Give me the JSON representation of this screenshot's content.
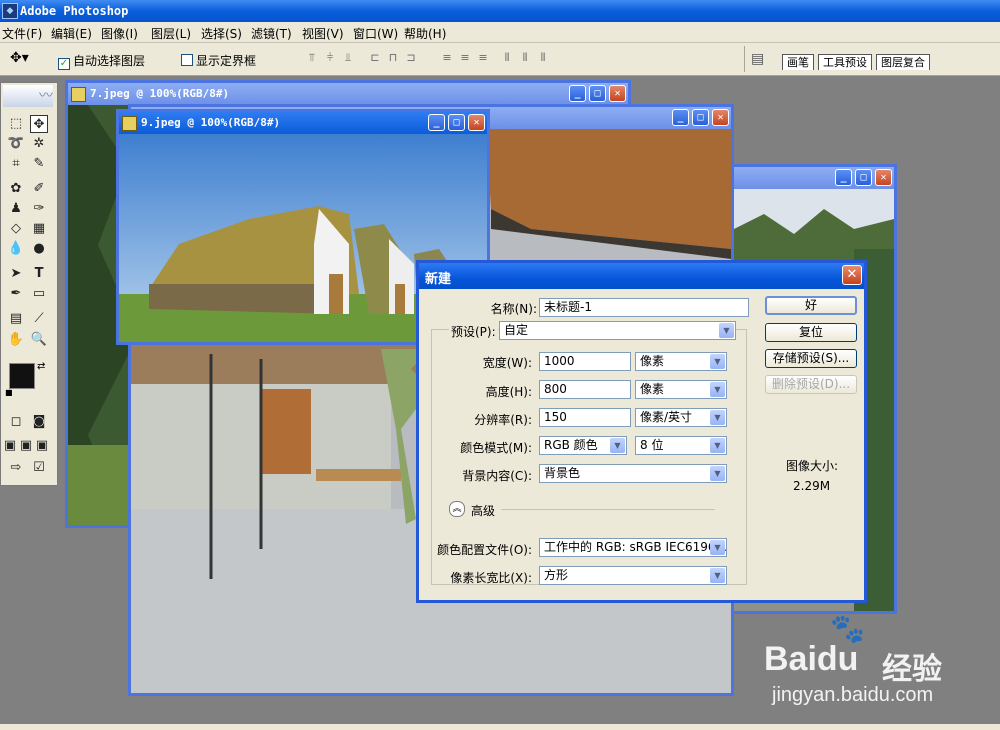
{
  "app": {
    "title": "Adobe Photoshop"
  },
  "menu": [
    "文件(F)",
    "编辑(E)",
    "图像(I)",
    "图层(L)",
    "选择(S)",
    "滤镜(T)",
    "视图(V)",
    "窗口(W)",
    "帮助(H)"
  ],
  "options": {
    "auto_select": "自动选择图层",
    "show_bounds": "显示定界框"
  },
  "palette_well": {
    "tabs": [
      "画笔",
      "工具预设",
      "图层复合"
    ]
  },
  "documents": {
    "doc7": {
      "title": "7.jpeg @ 100%(RGB/8#)"
    },
    "doc9": {
      "title": "9.jpeg @ 100%(RGB/8#)"
    }
  },
  "dialog": {
    "title": "新建",
    "name_label": "名称(N):",
    "name_value": "未标题-1",
    "preset_label": "预设(P):",
    "preset_value": "自定",
    "width_label": "宽度(W):",
    "width_value": "1000",
    "width_unit": "像素",
    "height_label": "高度(H):",
    "height_value": "800",
    "height_unit": "像素",
    "resolution_label": "分辨率(R):",
    "resolution_value": "150",
    "resolution_unit": "像素/英寸",
    "color_mode_label": "颜色模式(M):",
    "color_mode_value": "RGB 颜色",
    "bit_depth": "8 位",
    "background_label": "背景内容(C):",
    "background_value": "背景色",
    "advanced_label": "高级",
    "profile_label": "颜色配置文件(O):",
    "profile_value": "工作中的 RGB: sRGB IEC6196...",
    "aspect_label": "像素长宽比(X):",
    "aspect_value": "方形",
    "ok_button": "好",
    "reset_button": "复位",
    "save_preset_button": "存储预设(S)...",
    "delete_preset_button": "删除预设(D)...",
    "image_size_label": "图像大小:",
    "image_size_value": "2.29M"
  },
  "watermark": {
    "brand": "Baidu",
    "brand_cn": "经验",
    "url": "jingyan.baidu.com"
  },
  "colors": {
    "titlebar": "#0a5fd9",
    "chrome": "#ece9d8",
    "workspace": "#808080"
  }
}
